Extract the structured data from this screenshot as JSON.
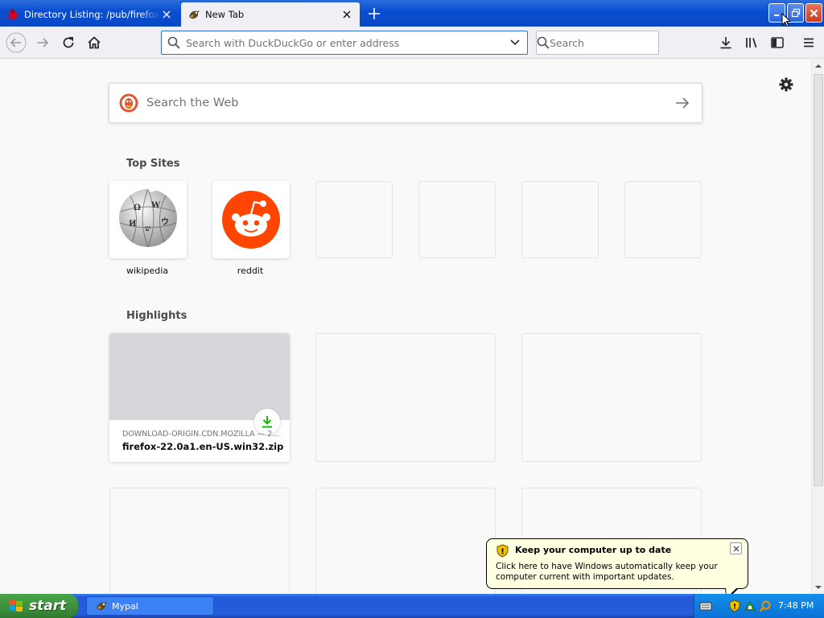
{
  "tabs": [
    {
      "label": "Directory Listing: /pub/firefox/nightly/",
      "active": false
    },
    {
      "label": "New Tab",
      "active": true
    }
  ],
  "urlbar": {
    "placeholder": "Search with DuckDuckGo or enter address",
    "value": ""
  },
  "searchbar": {
    "placeholder": "Search"
  },
  "websearch": {
    "placeholder": "Search the Web"
  },
  "top_sites": {
    "title": "Top Sites",
    "items": [
      {
        "label": "wikipedia",
        "icon": "wikipedia-globe-icon"
      },
      {
        "label": "reddit",
        "icon": "reddit-alien-icon"
      },
      {
        "label": ""
      },
      {
        "label": ""
      },
      {
        "label": ""
      },
      {
        "label": ""
      }
    ]
  },
  "highlights": {
    "title": "Highlights",
    "items": [
      {
        "source": "DOWNLOAD-ORIGIN.CDN.MOZILLA — 2...",
        "title": "firefox-22.0a1.en-US.win32.zip",
        "badge": "download-icon"
      }
    ]
  },
  "balloon": {
    "title": "Keep your computer up to date",
    "text": "Click here to have Windows automatically keep your computer current with important updates."
  },
  "taskbar": {
    "start_label": "start",
    "tasks": [
      {
        "label": "Mypal"
      }
    ],
    "clock": "7:48 PM"
  },
  "colors": {
    "accent": "#0a84ff",
    "reddit": "#ff4500",
    "download_green": "#12bc00",
    "xp_blue": "#245ddb",
    "xp_green": "#3c8e3c"
  }
}
